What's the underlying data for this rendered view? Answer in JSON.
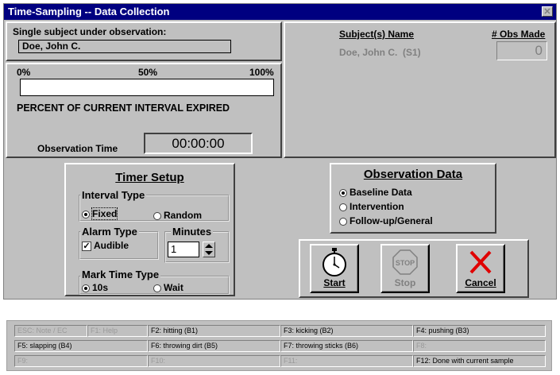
{
  "window": {
    "title": "Time-Sampling -- Data Collection",
    "close_glyph": "✕"
  },
  "subject_panel": {
    "label": "Single subject under observation:",
    "value": "Doe, John C."
  },
  "progress": {
    "label_0": "0%",
    "label_50": "50%",
    "label_100": "100%",
    "fraction": 0,
    "caption": "PERCENT OF CURRENT INTERVAL EXPIRED"
  },
  "observation_time": {
    "label": "Observation Time",
    "value": "00:00:00"
  },
  "subjects_list": {
    "name_header": "Subject(s) Name",
    "obs_header": "# Obs Made",
    "rows": [
      {
        "name": "Doe, John C.  (S1)",
        "obs": "0"
      }
    ]
  },
  "timer_setup": {
    "title": "Timer Setup",
    "interval_type": {
      "label": "Interval Type",
      "fixed": "Fixed",
      "random": "Random",
      "selected": "fixed"
    },
    "alarm_type": {
      "label": "Alarm Type",
      "audible": "Audible",
      "checked": true
    },
    "minutes": {
      "label": "Minutes",
      "value": "1"
    },
    "mark_time_type": {
      "label": "Mark Time Type",
      "opt1": "10s",
      "opt2": "Wait",
      "selected": "10s"
    }
  },
  "observation_data": {
    "title": "Observation Data",
    "options": [
      "Baseline Data",
      "Intervention",
      "Follow-up/General"
    ],
    "selected": 0
  },
  "buttons": {
    "start": "Start",
    "stop": "Stop",
    "cancel": "Cancel",
    "stop_sign": "STOP"
  },
  "fkeys": [
    [
      "ESC: Note / EC",
      "F1: Help",
      "F2: hitting (B1)",
      "F3: kicking (B2)",
      "F4: pushing (B3)"
    ],
    [
      "F5: slapping (B4)",
      "F6: throwing dirt (B5)",
      "F7: throwing sticks (B6)",
      "F8:"
    ],
    [
      "F9:",
      "F10:",
      "F11:",
      "F12: Done with current sample"
    ]
  ],
  "colors": {
    "title_bg": "#000080",
    "face": "#c0c0c0",
    "cancel_x": "#e00000"
  }
}
